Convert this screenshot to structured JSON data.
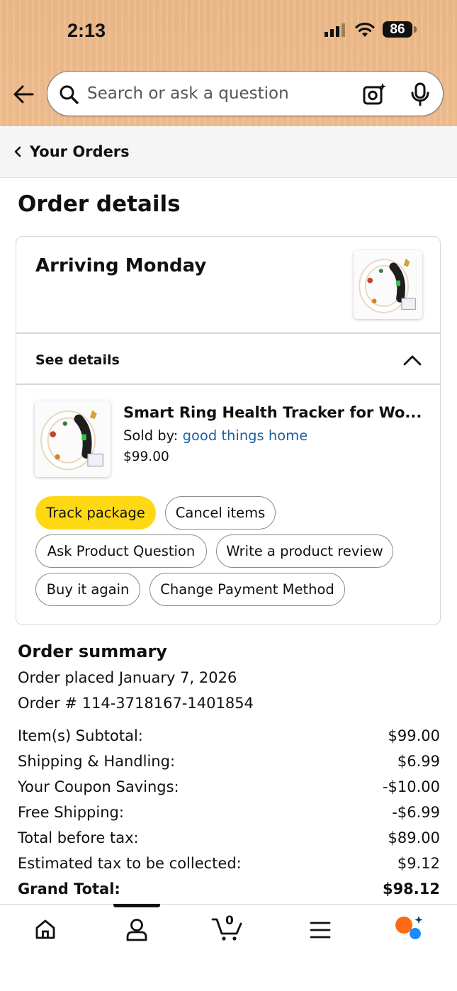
{
  "status_bar": {
    "time": "2:13",
    "battery": "86"
  },
  "search": {
    "placeholder": "Search or ask a question"
  },
  "breadcrumb": {
    "label": "Your Orders"
  },
  "page": {
    "title": "Order details"
  },
  "order_card": {
    "arriving": "Arriving Monday",
    "see_details": "See details",
    "item": {
      "title": "Smart Ring Health Tracker for Wo...",
      "sold_by_prefix": "Sold by: ",
      "seller": "good things home",
      "price": "$99.00"
    },
    "buttons": {
      "track": "Track package",
      "cancel": "Cancel items",
      "ask": "Ask Product Question",
      "review": "Write a product review",
      "buy_again": "Buy it again",
      "change_payment": "Change Payment Method"
    }
  },
  "summary": {
    "title": "Order summary",
    "placed": "Order placed January 7, 2026",
    "order_number": "Order # 114-3718167-1401854",
    "rows": [
      {
        "label": "Item(s) Subtotal:",
        "value": "$99.00"
      },
      {
        "label": "Shipping & Handling:",
        "value": "$6.99"
      },
      {
        "label": "Your Coupon Savings:",
        "value": "-$10.00"
      },
      {
        "label": "Free Shipping:",
        "value": "-$6.99"
      },
      {
        "label": "Total before tax:",
        "value": "$89.00"
      },
      {
        "label": "Estimated tax to be collected:",
        "value": "$9.12"
      },
      {
        "label": "Grand Total:",
        "value": "$98.12"
      }
    ]
  },
  "bottom_nav": {
    "cart_count": "0",
    "icons": [
      "home-icon",
      "account-icon",
      "cart-icon",
      "menu-icon",
      "rufus-assistant-icon"
    ]
  },
  "colors": {
    "header_bg": "#f0bd8e",
    "primary_button": "#ffd814",
    "link": "#2162a1",
    "text": "#0f1111"
  }
}
